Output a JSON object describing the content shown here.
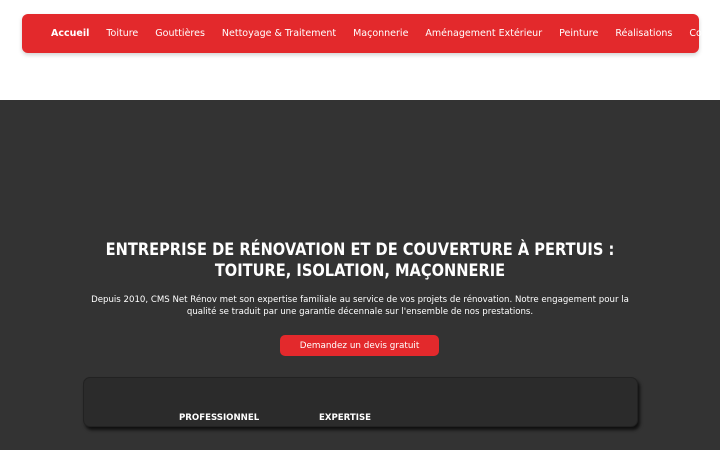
{
  "nav": {
    "items": [
      {
        "label": "Accueil",
        "active": true
      },
      {
        "label": "Toiture"
      },
      {
        "label": "Gouttières"
      },
      {
        "label": "Nettoyage & Traitement"
      },
      {
        "label": "Maçonnerie"
      },
      {
        "label": "Aménagement Extérieur"
      },
      {
        "label": "Peinture"
      },
      {
        "label": "Réalisations"
      },
      {
        "label": "Contact"
      }
    ]
  },
  "hero": {
    "title": "ENTREPRISE DE RÉNOVATION ET DE COUVERTURE À PERTUIS : TOITURE, ISOLATION, MAÇONNERIE",
    "description": "Depuis 2010, CMS Net Rénov met son expertise familiale au service de vos projets de rénovation. Notre engagement pour la qualité se traduit par une garantie décennale sur l'ensemble de nos prestations.",
    "cta_label": "Demandez un devis gratuit"
  },
  "features": {
    "items": [
      {
        "label": "PROFESSIONNEL"
      },
      {
        "label": "EXPERTISE"
      }
    ]
  },
  "colors": {
    "accent": "#e3292c",
    "hero_bg": "#333333",
    "text_on_dark": "#ffffff"
  }
}
